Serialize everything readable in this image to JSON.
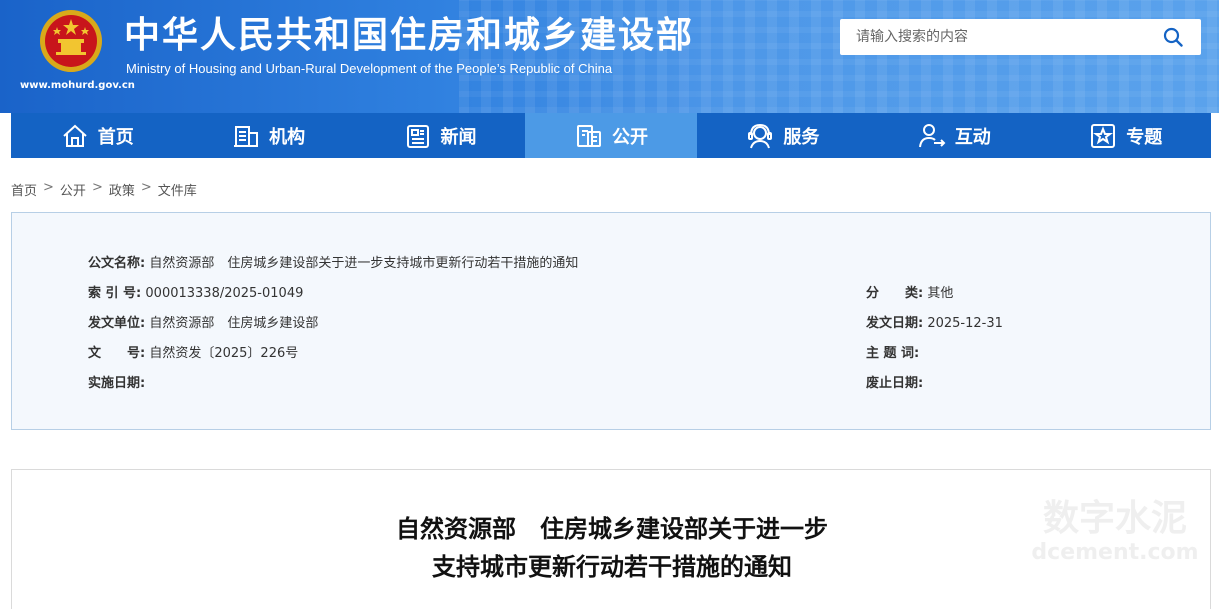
{
  "header": {
    "title_cn": "中华人民共和国住房和城乡建设部",
    "title_en": "Ministry of Housing and Urban-Rural Development of the People’s Republic of China",
    "site_url": "www.mohurd.gov.cn",
    "search_placeholder": "请输入搜索的内容",
    "accent": "#1463c4"
  },
  "nav": {
    "items": [
      {
        "label": "首页",
        "icon": "home-icon"
      },
      {
        "label": "机构",
        "icon": "building-icon"
      },
      {
        "label": "新闻",
        "icon": "news-icon"
      },
      {
        "label": "公开",
        "icon": "disclosure-icon",
        "active": true
      },
      {
        "label": "服务",
        "icon": "service-icon"
      },
      {
        "label": "互动",
        "icon": "interaction-icon"
      },
      {
        "label": "专题",
        "icon": "topic-icon"
      }
    ]
  },
  "breadcrumb": {
    "items": [
      "首页",
      "公开",
      "政策",
      "文件库"
    ],
    "separator": ">"
  },
  "meta": {
    "title_label": "公文名称:",
    "title_value": "自然资源部　住房城乡建设部关于进一步支持城市更新行动若干措施的通知",
    "index_label": "索 引 号:",
    "index_value": "000013338/2025-01049",
    "category_label": "分　　类:",
    "category_value": "其他",
    "issuer_label": "发文单位:",
    "issuer_value": "自然资源部　住房城乡建设部",
    "date_label": "发文日期:",
    "date_value": "2025-12-31",
    "docno_label": "文　　号:",
    "docno_value": "自然资发〔2025〕226号",
    "keywords_label": "主 题 词:",
    "keywords_value": "",
    "effective_label": "实施日期:",
    "effective_value": "",
    "expiry_label": "废止日期:",
    "expiry_value": ""
  },
  "document": {
    "title_line1": "自然资源部　住房城乡建设部关于进一步",
    "title_line2": "支持城市更新行动若干措施的通知"
  },
  "watermark": {
    "line1": "数字水泥",
    "line2": "dcement.com"
  }
}
